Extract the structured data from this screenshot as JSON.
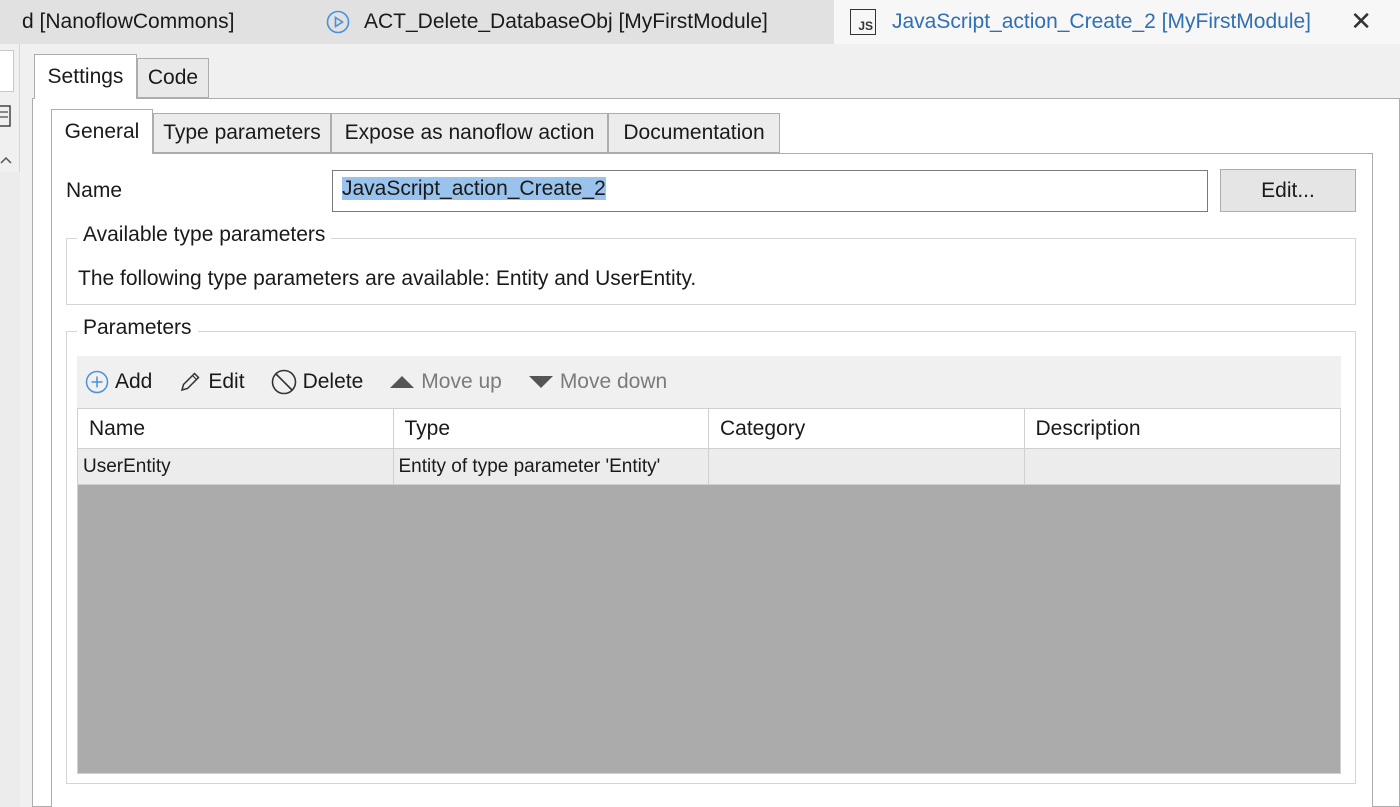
{
  "document_tabs": [
    {
      "label": "d [NanoflowCommons]",
      "icon": "",
      "active": false
    },
    {
      "label": "ACT_Delete_DatabaseObj [MyFirstModule]",
      "icon": "play-circle-icon",
      "active": false
    },
    {
      "label": "JavaScript_action_Create_2 [MyFirstModule]",
      "icon": "js-icon",
      "icon_text": "JS",
      "active": true
    }
  ],
  "close_glyph": "✕",
  "outer_tabs": [
    "Settings",
    "Code"
  ],
  "inner_tabs": [
    "General",
    "Type parameters",
    "Expose as nanoflow action",
    "Documentation"
  ],
  "general": {
    "name_label": "Name",
    "name_value": "JavaScript_action_Create_2",
    "edit_button": "Edit...",
    "type_params_group": {
      "title": "Available type parameters",
      "text": "The following type parameters are available: Entity and UserEntity."
    },
    "parameters_group": {
      "title": "Parameters",
      "toolbar": {
        "add": "Add",
        "edit": "Edit",
        "delete": "Delete",
        "move_up": "Move up",
        "move_down": "Move down"
      },
      "columns": [
        "Name",
        "Type",
        "Category",
        "Description"
      ],
      "rows": [
        {
          "name": "UserEntity",
          "type": "Entity of type parameter 'Entity'",
          "category": "",
          "description": ""
        }
      ]
    }
  },
  "colors": {
    "active_tab_text": "#2f6fb3",
    "selection": "#99c3ec",
    "grid_empty": "#ababab"
  }
}
